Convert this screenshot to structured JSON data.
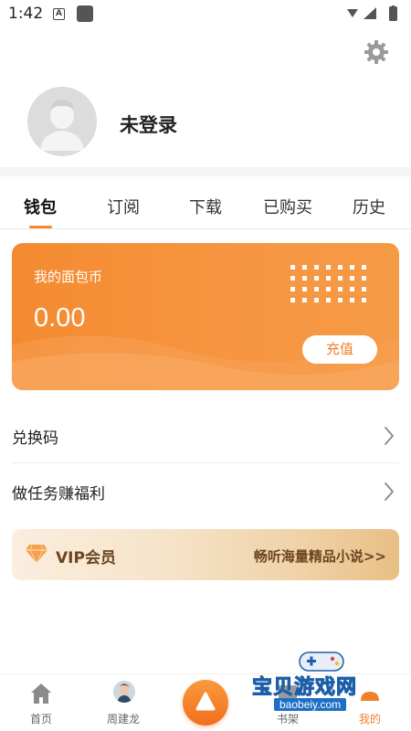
{
  "status_bar": {
    "time": "1:42",
    "notif_letter": "A"
  },
  "profile": {
    "login_status": "未登录"
  },
  "tabs": [
    {
      "label": "钱包",
      "active": true
    },
    {
      "label": "订阅",
      "active": false
    },
    {
      "label": "下载",
      "active": false
    },
    {
      "label": "已购买",
      "active": false
    },
    {
      "label": "历史",
      "active": false
    }
  ],
  "wallet": {
    "title": "我的面包币",
    "balance": "0.00",
    "recharge_label": "充值"
  },
  "menu": [
    {
      "label": "兑换码"
    },
    {
      "label": "做任务赚福利"
    }
  ],
  "vip": {
    "title": "VIP会员",
    "promo": "畅听海量精品小说>>"
  },
  "bottom_nav": [
    {
      "label": "首页",
      "icon": "home-icon",
      "active": false
    },
    {
      "label": "周建龙",
      "icon": "author-avatar",
      "active": false
    },
    {
      "label": "",
      "icon": "play-center-icon",
      "active": false
    },
    {
      "label": "书架",
      "icon": "bookshelf-icon",
      "active": false
    },
    {
      "label": "我的",
      "icon": "profile-icon",
      "active": true
    }
  ],
  "watermark": {
    "text": "宝贝游戏网",
    "url": "baobeiy.com"
  },
  "colors": {
    "accent": "#f6892b",
    "wallet_start": "#f48a30",
    "wallet_end": "#f59a45",
    "vip_text": "#6b4520"
  }
}
